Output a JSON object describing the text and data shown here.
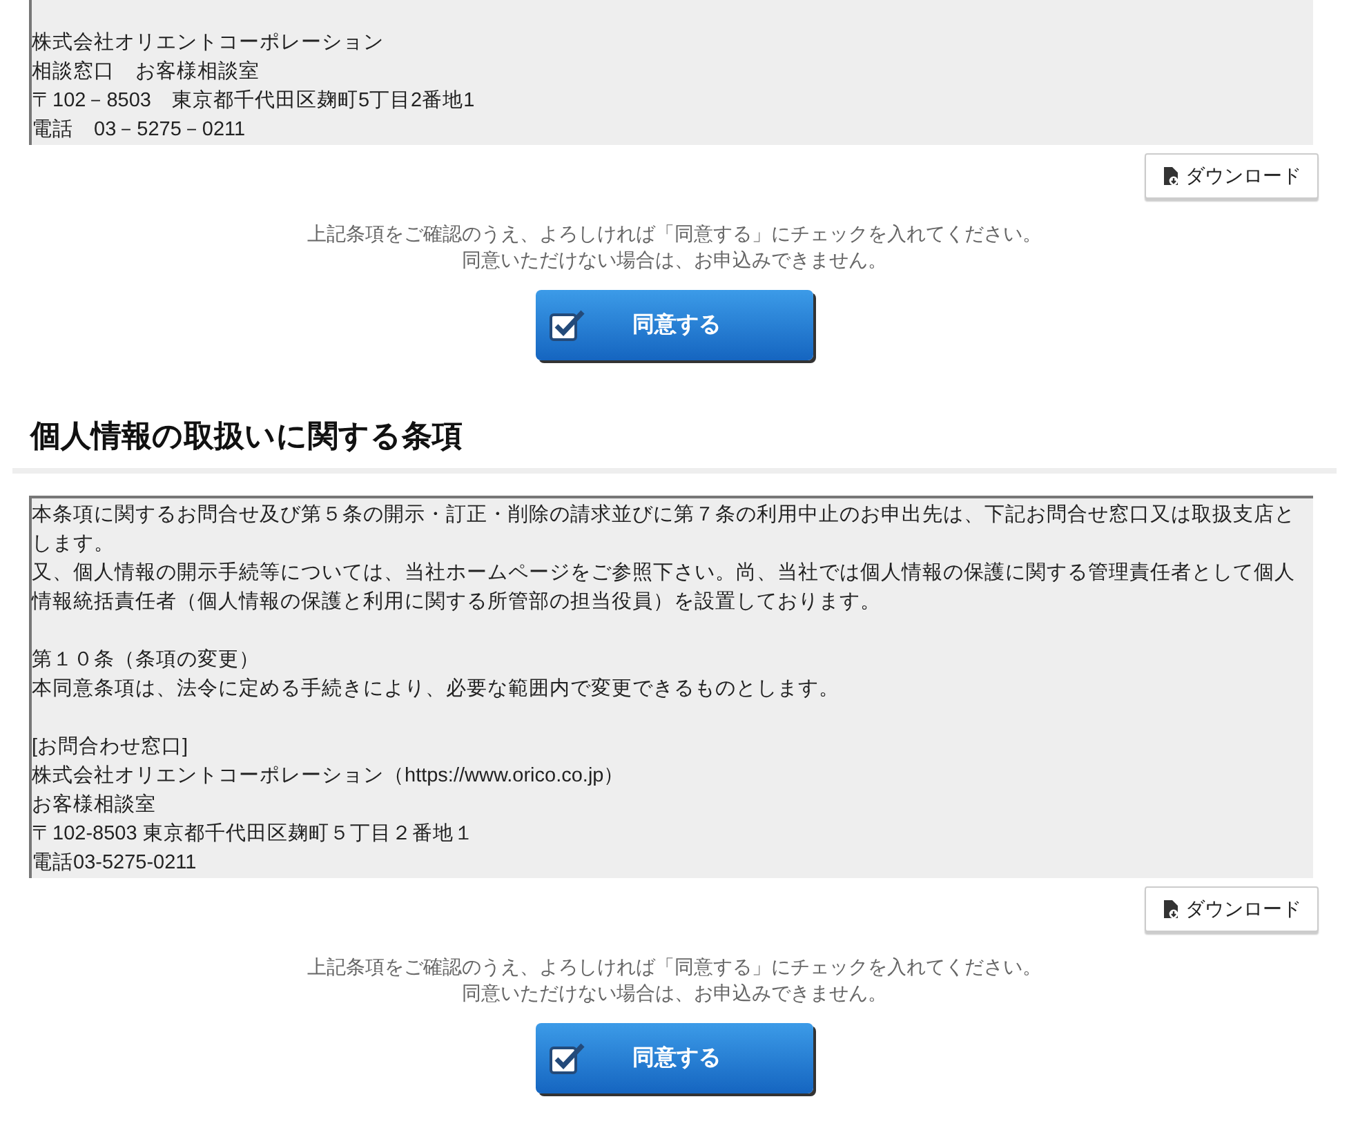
{
  "sections": [
    {
      "terms": [
        [
          "株式会社オリエントコーポレーション",
          "相談窓口　お客様相談室",
          "〒102－8503　東京都千代田区麹町5丁目2番地1",
          "電話　03－5275－0211"
        ]
      ],
      "download_label": "ダウンロード",
      "notice": [
        "上記条項をご確認のうえ、よろしければ「同意する」にチェックを入れてください。",
        "同意いただけない場合は、お申込みできません。"
      ],
      "agree_label": "同意する"
    },
    {
      "heading": "個人情報の取扱いに関する条項",
      "terms": [
        [
          "本条項に関するお問合せ及び第５条の開示・訂正・削除の請求並びに第７条の利用中止のお申出先は、下記お問合せ窓口又は取扱支店とします。",
          "又、個人情報の開示手続等については、当社ホームページをご参照下さい。尚、当社では個人情報の保護に関する管理責任者として個人情報統括責任者（個人情報の保護と利用に関する所管部の担当役員）を設置しております。"
        ],
        [
          "第１０条（条項の変更）",
          "本同意条項は、法令に定める手続きにより、必要な範囲内で変更できるものとします。"
        ],
        [
          "[お問合わせ窓口]",
          "株式会社オリエントコーポレーション（https://www.orico.co.jp）",
          "お客様相談室",
          "〒102-8503 東京都千代田区麹町５丁目２番地１",
          "電話03-5275-0211"
        ]
      ],
      "download_label": "ダウンロード",
      "notice": [
        "上記条項をご確認のうえ、よろしければ「同意する」にチェックを入れてください。",
        "同意いただけない場合は、お申込みできません。"
      ],
      "agree_label": "同意する"
    }
  ]
}
